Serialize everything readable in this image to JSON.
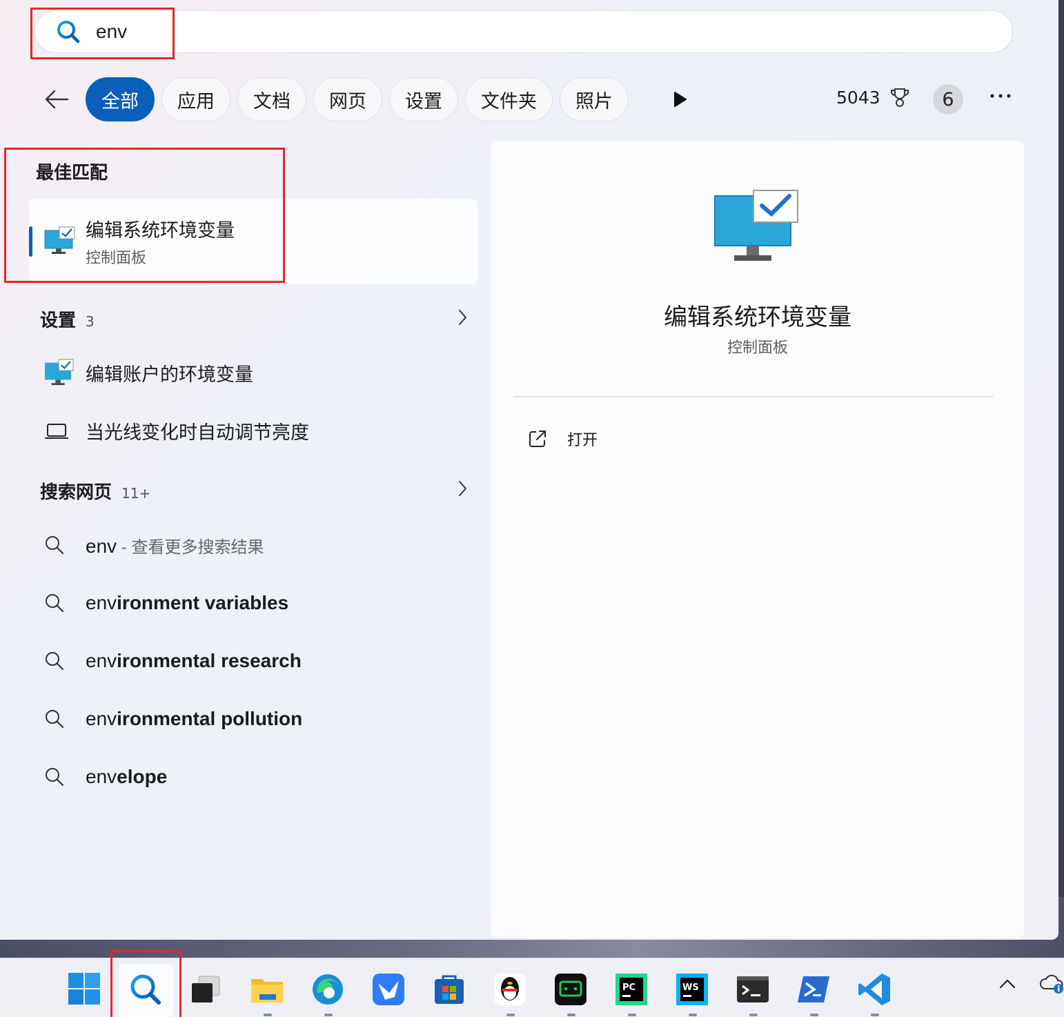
{
  "search": {
    "query": "env"
  },
  "filters": {
    "chips": [
      {
        "label": "全部",
        "active": true
      },
      {
        "label": "应用",
        "active": false
      },
      {
        "label": "文档",
        "active": false
      },
      {
        "label": "网页",
        "active": false
      },
      {
        "label": "设置",
        "active": false
      },
      {
        "label": "文件夹",
        "active": false
      },
      {
        "label": "照片",
        "active": false
      }
    ],
    "points": "5043",
    "badge_count": "6"
  },
  "best_match": {
    "heading": "最佳匹配",
    "title": "编辑系统环境变量",
    "subtitle": "控制面板"
  },
  "settings": {
    "heading": "设置",
    "count": "3",
    "items": [
      {
        "label": "编辑账户的环境变量",
        "icon": "monitor-check-icon"
      },
      {
        "label": "当光线变化时自动调节亮度",
        "icon": "laptop-icon"
      }
    ]
  },
  "web": {
    "heading": "搜索网页",
    "count": "11+",
    "first": {
      "term": "env",
      "suffix": " - 查看更多搜索结果"
    },
    "suggestions": [
      {
        "prefix": "env",
        "rest": "ironment variables"
      },
      {
        "prefix": "env",
        "rest": "ironmental research"
      },
      {
        "prefix": "env",
        "rest": "ironmental pollution"
      },
      {
        "prefix": "env",
        "rest": "elope"
      }
    ]
  },
  "preview": {
    "title": "编辑系统环境变量",
    "subtitle": "控制面板",
    "open_label": "打开"
  },
  "colors": {
    "accent": "#0a5fb8",
    "highlight": "#e5262c"
  }
}
